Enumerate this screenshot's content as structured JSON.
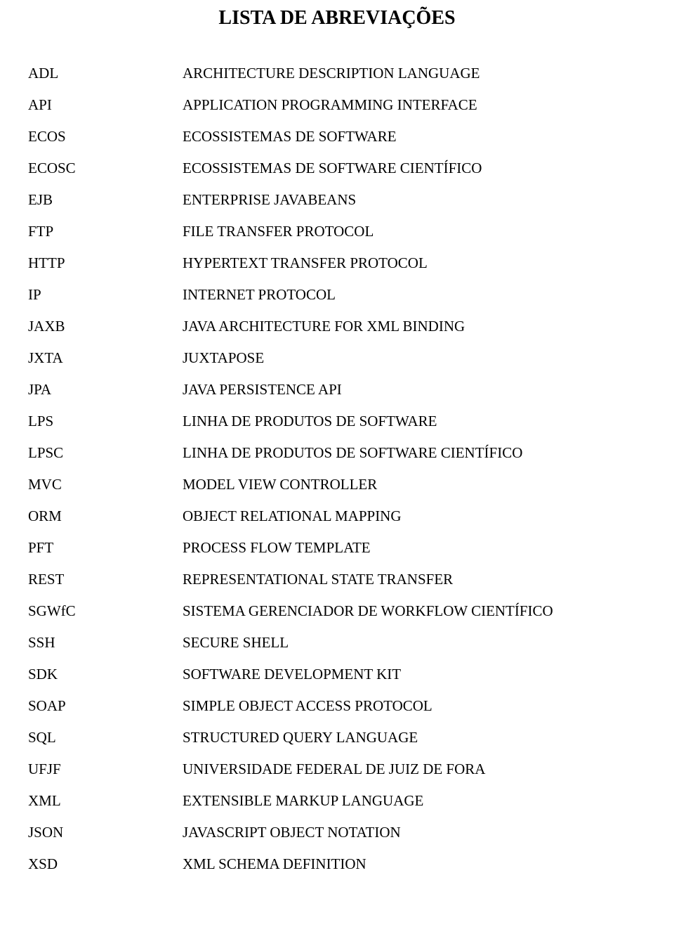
{
  "title": "LISTA DE ABREVIAÇÕES",
  "abbreviations": [
    {
      "abbr": "ADL",
      "def": "ARCHITECTURE DESCRIPTION LANGUAGE"
    },
    {
      "abbr": "API",
      "def": "APPLICATION PROGRAMMING INTERFACE"
    },
    {
      "abbr": "ECOS",
      "def": "ECOSSISTEMAS DE SOFTWARE"
    },
    {
      "abbr": "ECOSC",
      "def": "ECOSSISTEMAS DE SOFTWARE CIENTÍFICO"
    },
    {
      "abbr": "EJB",
      "def": "ENTERPRISE JAVABEANS"
    },
    {
      "abbr": "FTP",
      "def": "FILE TRANSFER PROTOCOL"
    },
    {
      "abbr": "HTTP",
      "def": "HYPERTEXT TRANSFER PROTOCOL"
    },
    {
      "abbr": "IP",
      "def": "INTERNET PROTOCOL"
    },
    {
      "abbr": "JAXB",
      "def": "JAVA ARCHITECTURE FOR XML BINDING"
    },
    {
      "abbr": "JXTA",
      "def": "JUXTAPOSE"
    },
    {
      "abbr": "JPA",
      "def": "JAVA PERSISTENCE API"
    },
    {
      "abbr": "LPS",
      "def": "LINHA DE PRODUTOS DE SOFTWARE"
    },
    {
      "abbr": "LPSC",
      "def": "LINHA DE PRODUTOS DE SOFTWARE CIENTÍFICO"
    },
    {
      "abbr": "MVC",
      "def": "MODEL VIEW CONTROLLER"
    },
    {
      "abbr": "ORM",
      "def": "OBJECT RELATIONAL MAPPING"
    },
    {
      "abbr": "PFT",
      "def": "PROCESS FLOW TEMPLATE"
    },
    {
      "abbr": "REST",
      "def": "REPRESENTATIONAL STATE TRANSFER"
    },
    {
      "abbr": "SGWfC",
      "def": "SISTEMA GERENCIADOR DE WORKFLOW CIENTÍFICO"
    },
    {
      "abbr": "SSH",
      "def": "SECURE SHELL"
    },
    {
      "abbr": "SDK",
      "def": "SOFTWARE DEVELOPMENT KIT"
    },
    {
      "abbr": "SOAP",
      "def": "SIMPLE OBJECT ACCESS PROTOCOL"
    },
    {
      "abbr": "SQL",
      "def": "STRUCTURED QUERY LANGUAGE"
    },
    {
      "abbr": "UFJF",
      "def": "UNIVERSIDADE FEDERAL DE JUIZ DE FORA"
    },
    {
      "abbr": "XML",
      "def": "EXTENSIBLE MARKUP LANGUAGE"
    },
    {
      "abbr": "JSON",
      "def": "JAVASCRIPT OBJECT NOTATION"
    },
    {
      "abbr": "XSD",
      "def": "XML SCHEMA DEFINITION"
    }
  ]
}
